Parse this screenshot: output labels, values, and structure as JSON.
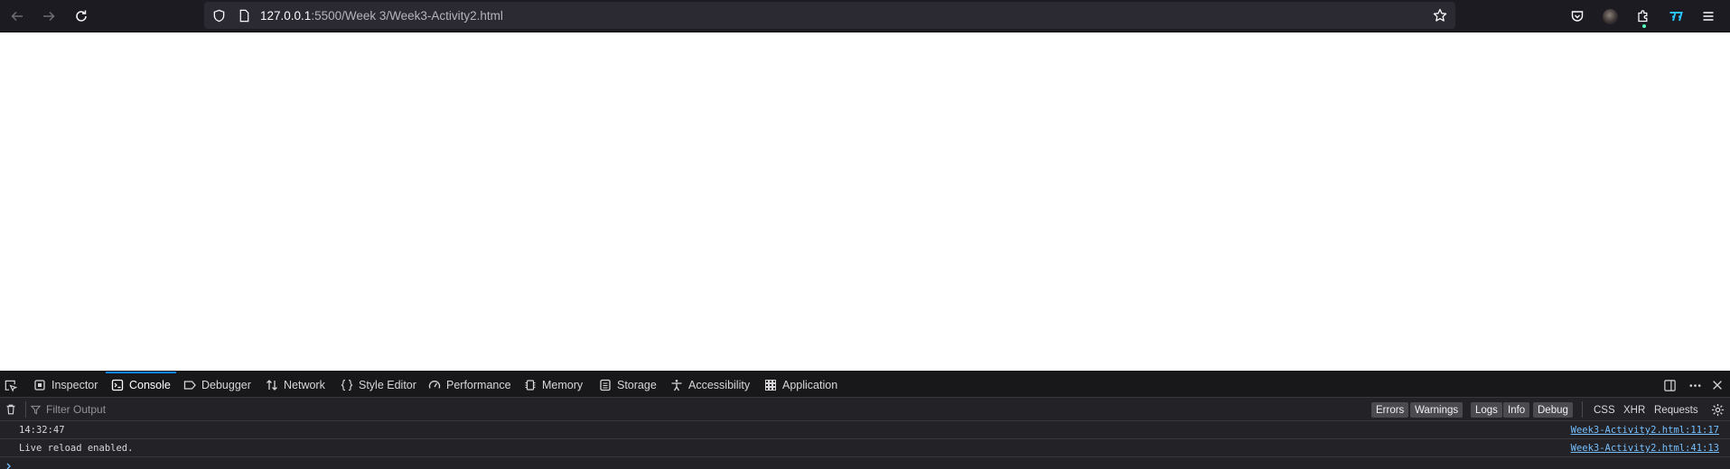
{
  "browser": {
    "url_host": "127.0.0.1",
    "url_rest": ":5500/Week 3/Week3-Activity2.html",
    "icons": {
      "back": "arrow-left-icon",
      "forward": "arrow-right-icon",
      "reload": "reload-icon",
      "shield": "shield-icon",
      "page": "page-icon",
      "bookmark": "star-icon",
      "pocket": "pocket-icon",
      "account": "avatar",
      "extensions": "puzzle-icon",
      "extension_app": "extension-icon",
      "menu": "hamburger-menu-icon"
    }
  },
  "devtools": {
    "tabs": [
      {
        "label": "Inspector",
        "icon": "inspector-icon"
      },
      {
        "label": "Console",
        "icon": "console-icon",
        "selected": true
      },
      {
        "label": "Debugger",
        "icon": "debugger-icon"
      },
      {
        "label": "Network",
        "icon": "network-icon"
      },
      {
        "label": "Style Editor",
        "icon": "style-editor-icon"
      },
      {
        "label": "Performance",
        "icon": "performance-icon"
      },
      {
        "label": "Memory",
        "icon": "memory-icon"
      },
      {
        "label": "Storage",
        "icon": "storage-icon"
      },
      {
        "label": "Accessibility",
        "icon": "accessibility-icon"
      },
      {
        "label": "Application",
        "icon": "application-icon"
      }
    ],
    "filter": {
      "placeholder": "Filter Output",
      "levels": [
        "Errors",
        "Warnings",
        "Logs",
        "Info",
        "Debug"
      ],
      "types": [
        "CSS",
        "XHR",
        "Requests"
      ]
    },
    "console_logs": [
      {
        "message": "14:32:47",
        "source": "Week3-Activity2.html:11:17"
      },
      {
        "message": "Live reload enabled.",
        "source": "Week3-Activity2.html:41:13"
      }
    ]
  },
  "colors": {
    "toolbar_bg": "#1c1b22",
    "urlbar_bg": "#2b2a33",
    "devtools_bg": "#232327",
    "accent": "#0a84ff",
    "link": "#75bfff"
  }
}
